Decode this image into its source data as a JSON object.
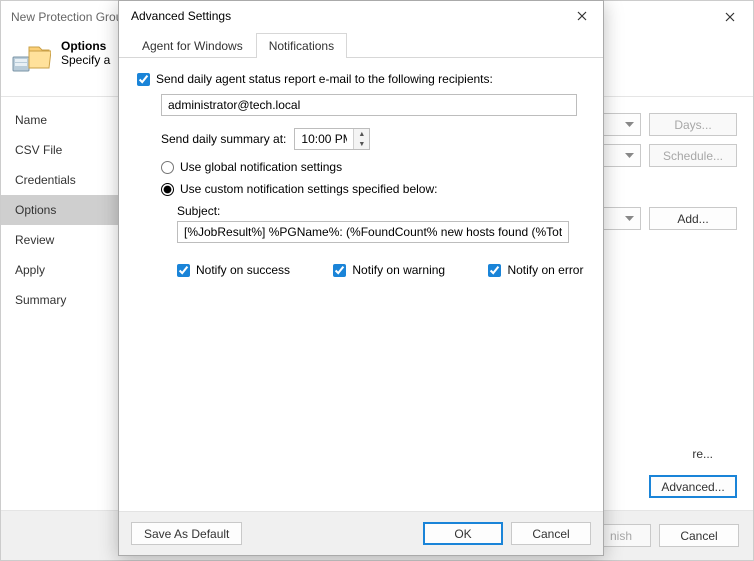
{
  "wizard": {
    "title": "New Protection Group",
    "heading": "Options",
    "subheading": "Specify a",
    "sidebar": [
      "Name",
      "CSV File",
      "Credentials",
      "Options",
      "Review",
      "Apply",
      "Summary"
    ],
    "active_sidebar_index": 3,
    "buttons": {
      "days": "Days...",
      "schedule": "Schedule...",
      "add": "Add...",
      "advanced": "Advanced...",
      "finish": "nish",
      "cancel": "Cancel"
    },
    "truncated_text": "re..."
  },
  "dialog": {
    "title": "Advanced Settings",
    "tabs": [
      "Agent for Windows",
      "Notifications"
    ],
    "active_tab_index": 1,
    "send_report_checkbox": "Send daily agent status report e-mail to the following recipients:",
    "send_report_checked": true,
    "recipients": "administrator@tech.local",
    "summary_label": "Send daily summary at:",
    "summary_time": "10:00 PM",
    "radio_global": "Use global notification settings",
    "radio_custom": "Use custom notification settings specified below:",
    "radio_selected": "custom",
    "subject_label": "Subject:",
    "subject_value": "[%JobResult%] %PGName%: (%FoundCount% new hosts found (%TotalCou",
    "notify_success": "Notify on success",
    "notify_warning": "Notify on warning",
    "notify_error": "Notify on error",
    "notify_success_checked": true,
    "notify_warning_checked": true,
    "notify_error_checked": true,
    "buttons": {
      "save_default": "Save As Default",
      "ok": "OK",
      "cancel": "Cancel"
    }
  }
}
